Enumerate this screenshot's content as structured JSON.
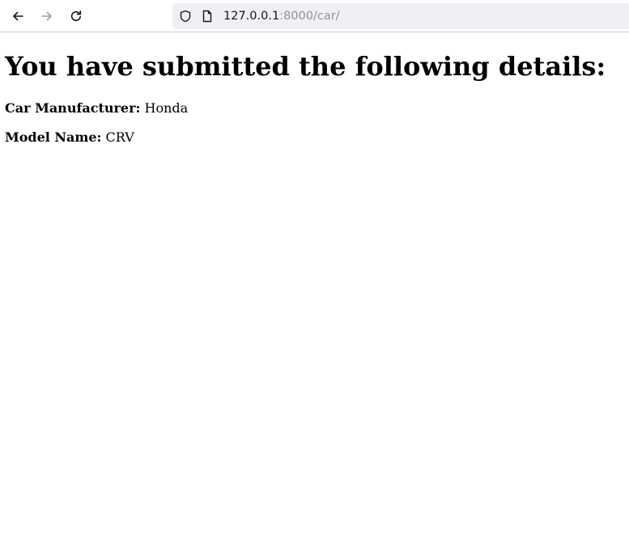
{
  "browser": {
    "url_host": "127.0.0.1",
    "url_path": ":8000/car/",
    "icons": {
      "back": "back-arrow-icon",
      "forward": "forward-arrow-icon",
      "reload": "reload-icon",
      "security": "shield-icon",
      "page": "page-icon"
    }
  },
  "page": {
    "heading": "You have submitted the following details:",
    "details": [
      {
        "label": "Car Manufacturer:",
        "value": "Honda"
      },
      {
        "label": "Model Name:",
        "value": "CRV"
      }
    ]
  }
}
